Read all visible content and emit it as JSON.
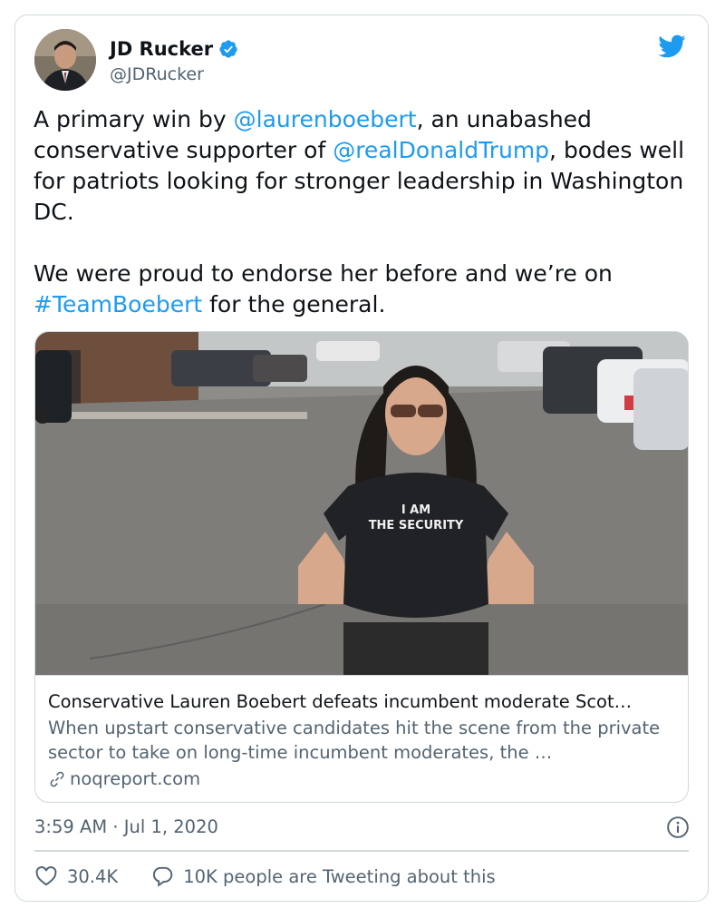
{
  "author": {
    "name": "JD Rucker",
    "handle": "@JDRucker",
    "verified": true
  },
  "tweet": {
    "p1": {
      "t1": "A primary win by ",
      "mention1": "@laurenboebert",
      "t2": ", an unabashed conservative supporter of ",
      "mention2": "@realDonaldTrump",
      "t3": ", bodes well for patriots looking for stronger leadership in Washington DC."
    },
    "p2": {
      "t1": "We were proud to endorse her before and we’re on ",
      "hashtag": "#TeamBoebert",
      "t2": " for the general."
    }
  },
  "link_card": {
    "title": "Conservative Lauren Boebert defeats incumbent moderate Scot…",
    "description": "When upstart conservative candidates hit the scene from the private sector to take on long-time incumbent moderates, the …",
    "domain": "noqreport.com",
    "shirt_text_line1": "I AM",
    "shirt_text_line2": "THE SECURITY"
  },
  "meta": {
    "timestamp": "3:59 AM · Jul 1, 2020"
  },
  "actions": {
    "likes": "30.4K",
    "reply_text": "10K people are Tweeting about this"
  },
  "colors": {
    "link": "#1d9bf0",
    "secondary_text": "#536471",
    "border": "#cfd9de",
    "like_icon": "#536471"
  },
  "icons": [
    "verified-badge-icon",
    "twitter-bird-icon",
    "link-icon",
    "info-icon",
    "heart-icon",
    "speech-bubble-icon"
  ]
}
